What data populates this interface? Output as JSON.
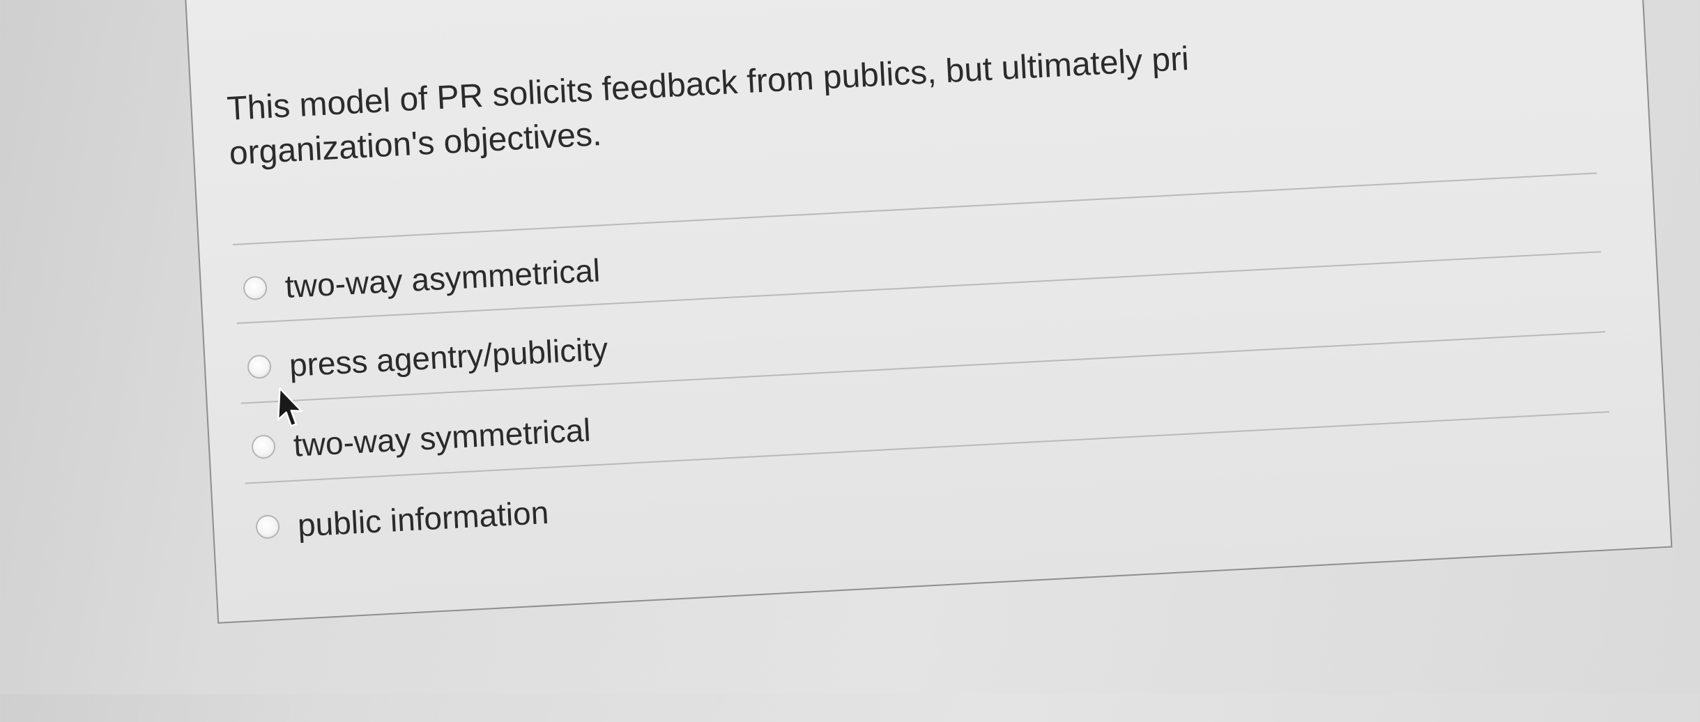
{
  "question": {
    "line1": "This model of PR solicits feedback from publics, but ultimately pri",
    "line2": "organization's objectives."
  },
  "options": [
    {
      "label": "two-way asymmetrical",
      "selected": false
    },
    {
      "label": "press agentry/publicity",
      "selected": false
    },
    {
      "label": "two-way symmetrical",
      "selected": false
    },
    {
      "label": "public information",
      "selected": false
    }
  ],
  "cursor": {
    "icon": "arrow-cursor-icon"
  }
}
